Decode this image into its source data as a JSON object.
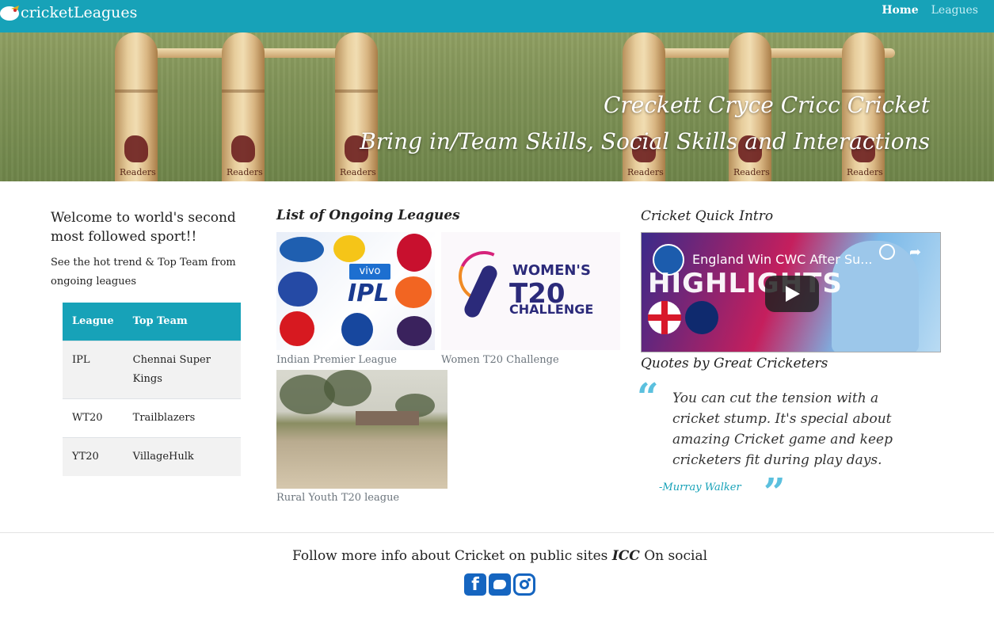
{
  "navbar": {
    "brand": "cricketLeagues",
    "links": [
      {
        "label": "Home",
        "active": true
      },
      {
        "label": "Leagues",
        "active": false
      }
    ],
    "bg_color": "#17a2b8"
  },
  "hero": {
    "line1": "Creckett Cryce Cricc Cricket",
    "line2": "Bring in/Team Skills, Social Skills and Interactions"
  },
  "left": {
    "welcome": "Welcome to world's second most followed sport!!",
    "subtext": "See the hot trend & Top Team from ongoing leagues",
    "table": {
      "headers": [
        "League",
        "Top Team"
      ],
      "rows": [
        [
          "IPL",
          "Chennai Super Kings"
        ],
        [
          "WT20",
          "Trailblazers"
        ],
        [
          "YT20",
          "VillageHulk"
        ]
      ]
    }
  },
  "middle": {
    "title": "List of Ongoing Leagues",
    "cards": [
      {
        "caption": "Indian Premier League",
        "image_text": {
          "brand": "vivo",
          "logo": "IPL"
        }
      },
      {
        "caption": "Women T20 Challenge",
        "image_text": {
          "line1": "WOMEN'S",
          "line2": "T20",
          "line3": "CHALLENGE"
        }
      },
      {
        "caption": "Rural Youth T20 league"
      }
    ]
  },
  "right": {
    "intro_title": "Cricket Quick Intro",
    "video": {
      "title": "England Win CWC After Su...",
      "overlay": "HIGHLIGHTS"
    },
    "quotes_title": "Quotes by Great Cricketers",
    "quote": "You can cut the tension with a cricket stump. It's special about amazing Cricket game and keep cricketers fit during play days.",
    "author": "-Murray Walker"
  },
  "footer": {
    "text_before": "Follow more info about Cricket on public sites ",
    "text_bold": "ICC",
    "text_after": " On social",
    "social": [
      "facebook-icon",
      "twitter-icon",
      "instagram-icon"
    ]
  },
  "colors": {
    "accent": "#17a2b8",
    "quote_mark": "#5bc0de",
    "social": "#1565c0"
  }
}
